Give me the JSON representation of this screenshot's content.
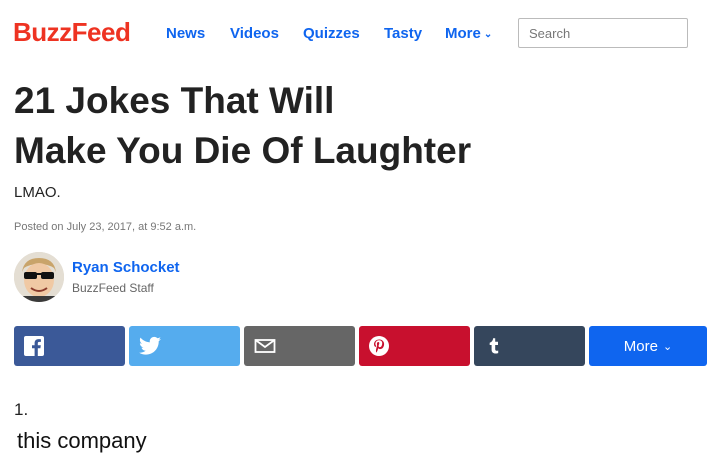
{
  "header": {
    "logo": "BuzzFeed",
    "nav": [
      "News",
      "Videos",
      "Quizzes",
      "Tasty",
      "More"
    ],
    "search_placeholder": "Search"
  },
  "article": {
    "title_line1": "21 Jokes That Will",
    "title_line2": "Make You Die Of Laughter",
    "dek": "LMAO.",
    "posted": "Posted on July 23, 2017, at 9:52 a.m.",
    "author": {
      "name": "Ryan Schocket",
      "role": "BuzzFeed Staff"
    }
  },
  "share": {
    "buttons": [
      {
        "network": "facebook",
        "icon": "facebook-icon",
        "color": "#3b5998"
      },
      {
        "network": "twitter",
        "icon": "twitter-icon",
        "color": "#55acee"
      },
      {
        "network": "email",
        "icon": "email-icon",
        "color": "#666666"
      },
      {
        "network": "pinterest",
        "icon": "pinterest-icon",
        "color": "#c8102e"
      },
      {
        "network": "tumblr",
        "icon": "tumblr-icon",
        "color": "#35465c"
      }
    ],
    "more_label": "More",
    "more_color": "#0f65ef"
  },
  "content": {
    "item_number": "1.",
    "item_text": "this company"
  },
  "colors": {
    "brand": "#ee3322",
    "link": "#0f65ef"
  }
}
